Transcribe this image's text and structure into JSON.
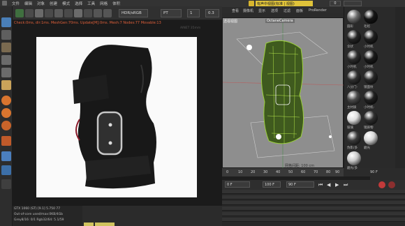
{
  "menu": {
    "items": [
      "文件",
      "编辑",
      "对象",
      "创建",
      "模式",
      "选择",
      "工具",
      "网格",
      "体积"
    ]
  },
  "toolbar": {
    "colorspace": "HDR/sRGB",
    "pt": "PT",
    "spinner_a": "1",
    "spinner_b": "0.3"
  },
  "viewport": {
    "status": "Check:0ms, dir:1ms. MeshGen:70ms. Update[M]:0ms. Mesh:7 Nodes:77 Movable:13",
    "right_label": "AINET 35mm",
    "info_lines": [
      "GTX 1060 (ST) [9.1]        5.750        77",
      "Out-of-core used/max:0KB/4Gb",
      "Grey8/16: 0/1          Rgb32/64: 5.1/59"
    ]
  },
  "right_header": {
    "title": "有声中视图(标准 | 视图)",
    "count": "0"
  },
  "right_menu": [
    "查看",
    "摄像机",
    "显示",
    "选项",
    "过滤",
    "面板",
    "ProRender"
  ],
  "c4d_viewport": {
    "view_label": "透视视图",
    "camera_label": "OctaneCamera",
    "distance_label": "网格间距: 100 cm"
  },
  "timeline": {
    "ticks": [
      "0",
      "10",
      "20",
      "30",
      "40",
      "50",
      "60",
      "70",
      "80",
      "90"
    ],
    "end": "90 F"
  },
  "transport": {
    "start": "0 F",
    "current": "0 F",
    "max": "100 F",
    "end": "90 F"
  },
  "materials": {
    "items": [
      {
        "label": "圆形",
        "color": "#6a6a6a"
      },
      {
        "label": "毛毡",
        "color": "#151515"
      },
      {
        "label": "伞状",
        "color": "#252525"
      },
      {
        "label": "小时机",
        "color": "#1f1f1f"
      },
      {
        "label": "小时机",
        "color": "#2d2d2d"
      },
      {
        "label": "小时机",
        "color": "#1a1a1a"
      },
      {
        "label": "八分门-",
        "color": "#303030"
      },
      {
        "label": "镜面纹",
        "color": "#282828"
      },
      {
        "label": "主材质",
        "color": "#4a4a4a"
      },
      {
        "label": "小时机-",
        "color": "#202020"
      },
      {
        "label": "玻璃",
        "color": "#e0e0e0"
      },
      {
        "label": "镜质物",
        "color": "#2f2f2f"
      },
      {
        "label": "伪影/多",
        "color": "#3a3a3a"
      },
      {
        "label": "磨光",
        "color": "#d8d8d8"
      },
      {
        "label": "磨光/多",
        "color": "#cacaca"
      }
    ]
  }
}
